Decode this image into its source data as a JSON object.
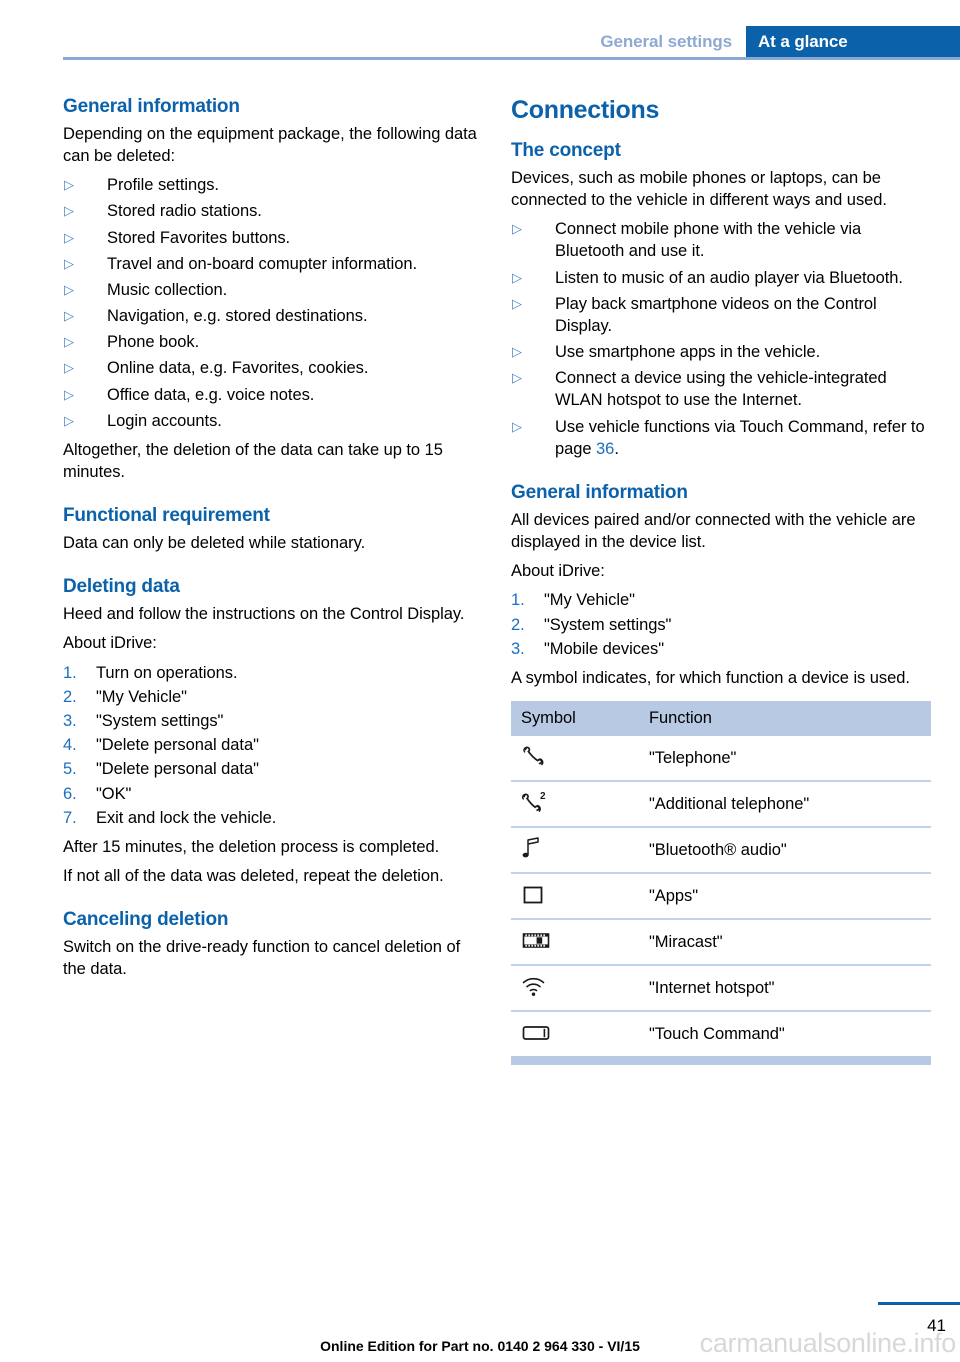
{
  "header": {
    "inactive_tab": "General settings",
    "active_tab": "At a glance"
  },
  "colors": {
    "heading_blue": "#0b62aa",
    "active_tab_bg": "#0b62aa",
    "inactive_tab_text": "#8ea9d2",
    "rule_blue": "#8ba8d4",
    "table_header_bg": "#b8c9e4",
    "table_row_border": "#c2d2ea",
    "bullet_blue": "#4d85c4",
    "number_blue": "#1a6fc0"
  },
  "left_column": {
    "heading_general_information": "General information",
    "intro": "Depending on the equipment package, the following data can be deleted:",
    "deletable_items": [
      "Profile settings.",
      "Stored radio stations.",
      "Stored Favorites buttons.",
      "Travel and on-board comupter information.",
      "Music collection.",
      "Navigation, e.g. stored destinations.",
      "Phone book.",
      "Online data, e.g. Favorites, cookies.",
      "Office data, e.g. voice notes.",
      "Login accounts."
    ],
    "duration_note": "Altogether, the deletion of the data can take up to 15 minutes.",
    "heading_functional_requirement": "Functional requirement",
    "functional_requirement_text": "Data can only be deleted while stationary.",
    "heading_deleting_data": "Deleting data",
    "deleting_data_intro": "Heed and follow the instructions on the Control Display.",
    "about_idrive_label": "About iDrive:",
    "deleting_steps": [
      "Turn on operations.",
      "\"My Vehicle\"",
      "\"System settings\"",
      "\"Delete personal data\"",
      "\"Delete personal data\"",
      "\"OK\"",
      "Exit and lock the vehicle."
    ],
    "after_note": "After 15 minutes, the deletion process is completed.",
    "repeat_note": "If not all of the data was deleted, repeat the deletion.",
    "heading_canceling_deletion": "Canceling deletion",
    "canceling_text": "Switch on the drive-ready function to cancel deletion of the data."
  },
  "right_column": {
    "heading_connections": "Connections",
    "heading_the_concept": "The concept",
    "concept_intro": "Devices, such as mobile phones or laptops, can be connected to the vehicle in different ways and used.",
    "concept_items": [
      "Connect mobile phone with the vehicle via Bluetooth and use it.",
      "Listen to music of an audio player via Bluetooth.",
      "Play back smartphone videos on the Control Display.",
      "Use smartphone apps in the vehicle.",
      "Connect a device using the vehicle-integrated WLAN hotspot to use the Internet."
    ],
    "touch_command_item_prefix": "Use vehicle functions via Touch Command, refer to page ",
    "touch_command_page_ref": "36",
    "touch_command_item_suffix": ".",
    "heading_general_information": "General information",
    "devices_intro": "All devices paired and/or connected with the vehicle are displayed in the device list.",
    "about_idrive_label": "About iDrive:",
    "idrive_steps": [
      "\"My Vehicle\"",
      "\"System settings\"",
      "\"Mobile devices\""
    ],
    "symbol_note": "A symbol indicates, for which function a device is used.",
    "table": {
      "headers": [
        "Symbol",
        "Function"
      ],
      "rows": [
        {
          "icon": "telephone-handset-icon",
          "function": "\"Telephone\""
        },
        {
          "icon": "telephone-handset-2-icon",
          "function": "\"Additional telephone\""
        },
        {
          "icon": "music-note-icon",
          "function": "\"Bluetooth® audio\""
        },
        {
          "icon": "apps-square-icon",
          "function": "\"Apps\""
        },
        {
          "icon": "film-strip-icon",
          "function": "\"Miracast\""
        },
        {
          "icon": "wifi-icon",
          "function": "\"Internet hotspot\""
        },
        {
          "icon": "touch-command-tablet-icon",
          "function": "\"Touch Command\""
        }
      ]
    }
  },
  "footer": {
    "page_number": "41",
    "edition_line": "Online Edition for Part no. 0140 2 964 330 - VI/15",
    "watermark": "carmanualsonline.info"
  }
}
